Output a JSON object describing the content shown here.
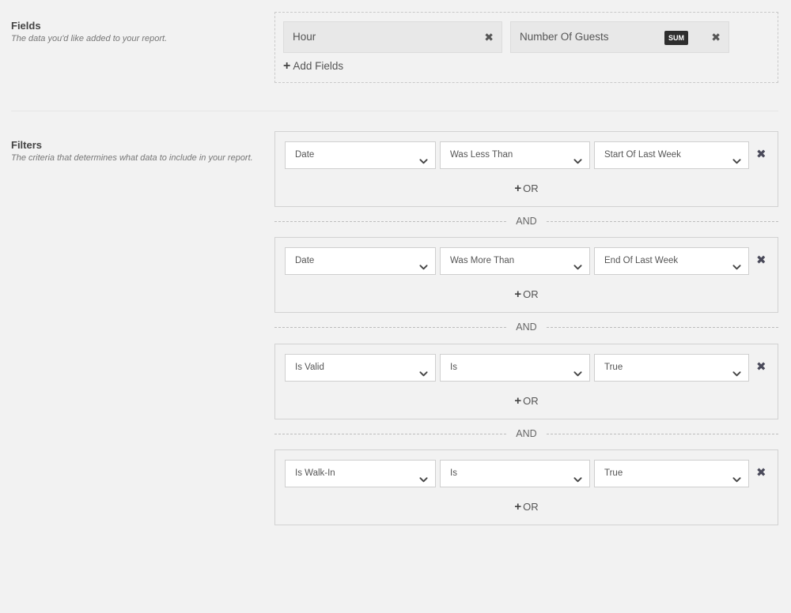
{
  "fields_section": {
    "title": "Fields",
    "description": "The data you'd like added to your report.",
    "chips": [
      {
        "label": "Hour",
        "close_icon": "✖"
      },
      {
        "label": "Number Of Guests",
        "badge": "SUM",
        "close_icon": "✖"
      }
    ],
    "add_label": "Add Fields",
    "add_icon": "+"
  },
  "filters_section": {
    "title": "Filters",
    "description": "The criteria that determines what data to include in your report.",
    "groups": [
      {
        "field": "Date",
        "operator": "Was Less Than",
        "value": "Start Of Last Week",
        "or_label": "OR"
      },
      {
        "field": "Date",
        "operator": "Was More Than",
        "value": "End Of Last Week",
        "or_label": "OR"
      },
      {
        "field": "Is Valid",
        "operator": "Is",
        "value": "True",
        "or_label": "OR"
      },
      {
        "field": "Is Walk-In",
        "operator": "Is",
        "value": "True",
        "or_label": "OR"
      }
    ],
    "and_label": "AND",
    "remove_icon": "✖",
    "plus_icon": "+"
  },
  "colors": {
    "background": "#f2f2f2",
    "badge": "#2e2e2e",
    "remove_icon": "#4a4a5a"
  }
}
